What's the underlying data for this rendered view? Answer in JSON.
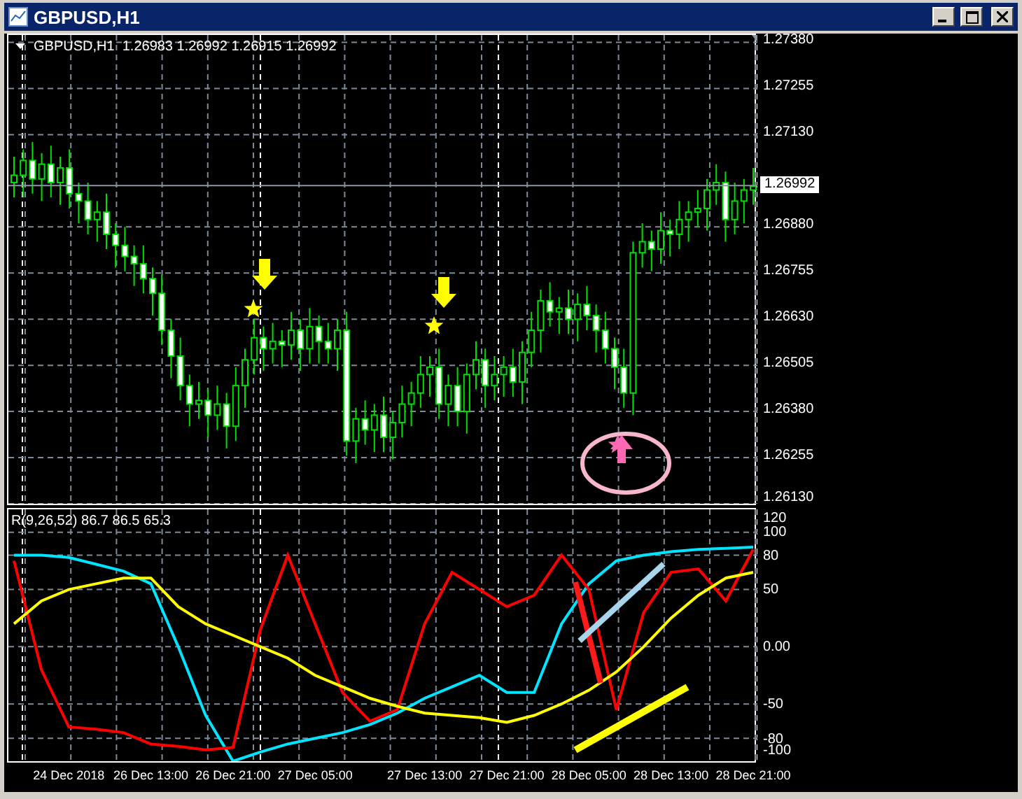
{
  "window": {
    "title": "GBPUSD,H1"
  },
  "main_chart": {
    "header": "GBPUSD,H1  1.26983 1.26992 1.26915 1.26992",
    "current_price": "1.26992",
    "chart_data": {
      "type": "candlestick",
      "grid": true,
      "ylim": [
        1.2613,
        1.274
      ],
      "yticks": [
        {
          "value": 1.2738,
          "label": "1.27380"
        },
        {
          "value": 1.27255,
          "label": "1.27255"
        },
        {
          "value": 1.2713,
          "label": "1.27130"
        },
        {
          "value": 1.2688,
          "label": "1.26880"
        },
        {
          "value": 1.26755,
          "label": "1.26755"
        },
        {
          "value": 1.2663,
          "label": "1.26630"
        },
        {
          "value": 1.26505,
          "label": "1.26505"
        },
        {
          "value": 1.2638,
          "label": "1.26380"
        },
        {
          "value": 1.26255,
          "label": "1.26255"
        },
        {
          "value": 1.2613,
          "label": "1.26130"
        }
      ],
      "categories": [
        null,
        null,
        null,
        null,
        null,
        null,
        null,
        null,
        null,
        null,
        null,
        null,
        null,
        null,
        null,
        null,
        null,
        null,
        null,
        null,
        null,
        null,
        null,
        null,
        null,
        null,
        null,
        null,
        null,
        null,
        null,
        null,
        null,
        null,
        null,
        null,
        null,
        null,
        null,
        null,
        null,
        null,
        null,
        null,
        null,
        null,
        null,
        null,
        null,
        null,
        null,
        null,
        null,
        null,
        null,
        null,
        null,
        null,
        null,
        null,
        null,
        null,
        null,
        null,
        null,
        null,
        null,
        null,
        null,
        null,
        null,
        null,
        null,
        null,
        null,
        null,
        null,
        null,
        null,
        null,
        null
      ],
      "ohlc": [
        [
          1.27,
          1.2707,
          1.2696,
          1.2702
        ],
        [
          1.2702,
          1.2709,
          1.2696,
          1.2706
        ],
        [
          1.2706,
          1.2711,
          1.2697,
          1.2701
        ],
        [
          1.2701,
          1.2708,
          1.2695,
          1.2705
        ],
        [
          1.2705,
          1.271,
          1.2696,
          1.27
        ],
        [
          1.27,
          1.2707,
          1.2694,
          1.2704
        ],
        [
          1.2704,
          1.2709,
          1.2693,
          1.2697
        ],
        [
          1.2697,
          1.27,
          1.2689,
          1.2695
        ],
        [
          1.2695,
          1.27,
          1.2686,
          1.269
        ],
        [
          1.269,
          1.2695,
          1.2684,
          1.2692
        ],
        [
          1.2692,
          1.2697,
          1.2682,
          1.2686
        ],
        [
          1.2686,
          1.2689,
          1.2677,
          1.2683
        ],
        [
          1.2683,
          1.2688,
          1.2676,
          1.268
        ],
        [
          1.268,
          1.2683,
          1.2672,
          1.2678
        ],
        [
          1.2678,
          1.2683,
          1.267,
          1.2674
        ],
        [
          1.2674,
          1.2677,
          1.2664,
          1.267
        ],
        [
          1.267,
          1.2675,
          1.2656,
          1.266
        ],
        [
          1.266,
          1.2663,
          1.2647,
          1.2653
        ],
        [
          1.2653,
          1.2658,
          1.2641,
          1.2645
        ],
        [
          1.2645,
          1.2648,
          1.2634,
          1.264
        ],
        [
          1.264,
          1.2646,
          1.2636,
          1.2641
        ],
        [
          1.2641,
          1.2644,
          1.2631,
          1.2637
        ],
        [
          1.2637,
          1.2645,
          1.2633,
          1.264
        ],
        [
          1.264,
          1.2643,
          1.2628,
          1.2634
        ],
        [
          1.2634,
          1.265,
          1.263,
          1.2645
        ],
        [
          1.2645,
          1.2655,
          1.2639,
          1.2652
        ],
        [
          1.2652,
          1.2663,
          1.2648,
          1.2658
        ],
        [
          1.2658,
          1.2661,
          1.2649,
          1.2655
        ],
        [
          1.2655,
          1.2662,
          1.2651,
          1.2657
        ],
        [
          1.2657,
          1.266,
          1.265,
          1.2656
        ],
        [
          1.2656,
          1.2665,
          1.2652,
          1.266
        ],
        [
          1.266,
          1.2663,
          1.2649,
          1.2655
        ],
        [
          1.2655,
          1.2666,
          1.2651,
          1.2661
        ],
        [
          1.2661,
          1.2664,
          1.2651,
          1.2657
        ],
        [
          1.2657,
          1.2662,
          1.2651,
          1.2655
        ],
        [
          1.2655,
          1.2663,
          1.2649,
          1.266
        ],
        [
          1.266,
          1.2665,
          1.2626,
          1.263
        ],
        [
          1.263,
          1.2639,
          1.2624,
          1.2636
        ],
        [
          1.2636,
          1.2641,
          1.2629,
          1.2633
        ],
        [
          1.2633,
          1.264,
          1.2627,
          1.2637
        ],
        [
          1.2637,
          1.2642,
          1.2627,
          1.2631
        ],
        [
          1.2631,
          1.2638,
          1.2625,
          1.2635
        ],
        [
          1.2635,
          1.2645,
          1.2631,
          1.264
        ],
        [
          1.264,
          1.2646,
          1.2634,
          1.2643
        ],
        [
          1.2643,
          1.2653,
          1.2639,
          1.2648
        ],
        [
          1.2648,
          1.2653,
          1.2642,
          1.265
        ],
        [
          1.265,
          1.2655,
          1.2636,
          1.264
        ],
        [
          1.264,
          1.2648,
          1.2634,
          1.2645
        ],
        [
          1.2645,
          1.265,
          1.2634,
          1.2638
        ],
        [
          1.2638,
          1.2651,
          1.2632,
          1.2648
        ],
        [
          1.2648,
          1.2657,
          1.2644,
          1.2652
        ],
        [
          1.2652,
          1.2655,
          1.2639,
          1.2645
        ],
        [
          1.2645,
          1.2653,
          1.2641,
          1.2648
        ],
        [
          1.2648,
          1.2653,
          1.2642,
          1.265
        ],
        [
          1.265,
          1.2655,
          1.2642,
          1.2646
        ],
        [
          1.2646,
          1.2657,
          1.264,
          1.2654
        ],
        [
          1.2654,
          1.2665,
          1.265,
          1.266
        ],
        [
          1.266,
          1.2671,
          1.2654,
          1.2668
        ],
        [
          1.2668,
          1.2673,
          1.2661,
          1.2665
        ],
        [
          1.2665,
          1.2669,
          1.2659,
          1.2666
        ],
        [
          1.2666,
          1.2671,
          1.2659,
          1.2663
        ],
        [
          1.2663,
          1.267,
          1.2657,
          1.2667
        ],
        [
          1.2667,
          1.2672,
          1.266,
          1.2664
        ],
        [
          1.2664,
          1.2667,
          1.2654,
          1.266
        ],
        [
          1.266,
          1.2665,
          1.2651,
          1.2655
        ],
        [
          1.2655,
          1.2658,
          1.2644,
          1.265
        ],
        [
          1.265,
          1.2655,
          1.2639,
          1.2643
        ],
        [
          1.2643,
          1.2684,
          1.2637,
          1.2681
        ],
        [
          1.2681,
          1.2689,
          1.2677,
          1.2684
        ],
        [
          1.2684,
          1.2687,
          1.2676,
          1.2682
        ],
        [
          1.2682,
          1.2692,
          1.2678,
          1.2687
        ],
        [
          1.2687,
          1.269,
          1.268,
          1.2686
        ],
        [
          1.2686,
          1.2695,
          1.2682,
          1.269
        ],
        [
          1.269,
          1.2695,
          1.2684,
          1.2692
        ],
        [
          1.2692,
          1.2698,
          1.2688,
          1.2693
        ],
        [
          1.2693,
          1.2701,
          1.2687,
          1.2698
        ],
        [
          1.2698,
          1.2705,
          1.2694,
          1.27
        ],
        [
          1.27,
          1.2703,
          1.2684,
          1.269
        ],
        [
          1.269,
          1.27,
          1.2686,
          1.2695
        ],
        [
          1.2695,
          1.2701,
          1.2689,
          1.2698
        ],
        [
          1.2698,
          1.2704,
          1.2694,
          1.2699
        ]
      ]
    }
  },
  "indicator": {
    "header": "R(9,26,52) 86.7 86.5 65.3",
    "chart_data": {
      "type": "line",
      "grid": true,
      "ylim": [
        -100,
        120
      ],
      "categories": [
        null,
        null,
        "24 Dec 2018",
        null,
        null,
        "26 Dec 13:00",
        null,
        null,
        "26 Dec 21:00",
        null,
        null,
        "27 Dec 05:00",
        null,
        null,
        null,
        "27 Dec 13:00",
        null,
        null,
        "27 Dec 21:00",
        null,
        null,
        "28 Dec 05:00",
        null,
        null,
        "28 Dec 13:00",
        null,
        null,
        "28 Dec 21:00"
      ],
      "yticks": [
        120,
        100,
        80,
        50,
        {
          "value": 0,
          "label": "0.00"
        },
        -50,
        -80,
        -100
      ],
      "series": [
        {
          "color": "#00e5ff",
          "values": [
            80,
            80,
            78,
            72,
            66,
            55,
            0,
            -60,
            -100,
            -92,
            -85,
            -80,
            -75,
            -68,
            -58,
            -45,
            -35,
            -25,
            -40,
            -40,
            20,
            55,
            75,
            80,
            83,
            85,
            86,
            87
          ]
        },
        {
          "color": "#ff0000",
          "values": [
            75,
            -20,
            -70,
            -72,
            -75,
            -85,
            -87,
            -90,
            -88,
            15,
            80,
            20,
            -40,
            -65,
            -55,
            20,
            65,
            50,
            35,
            45,
            80,
            50,
            -55,
            30,
            65,
            68,
            40,
            85
          ]
        },
        {
          "color": "#ffff00",
          "values": [
            20,
            40,
            50,
            55,
            60,
            60,
            35,
            20,
            10,
            0,
            -10,
            -25,
            -35,
            -45,
            -52,
            -58,
            -60,
            -62,
            -66,
            -60,
            -50,
            -38,
            -22,
            0,
            25,
            45,
            60,
            65
          ]
        }
      ]
    }
  }
}
